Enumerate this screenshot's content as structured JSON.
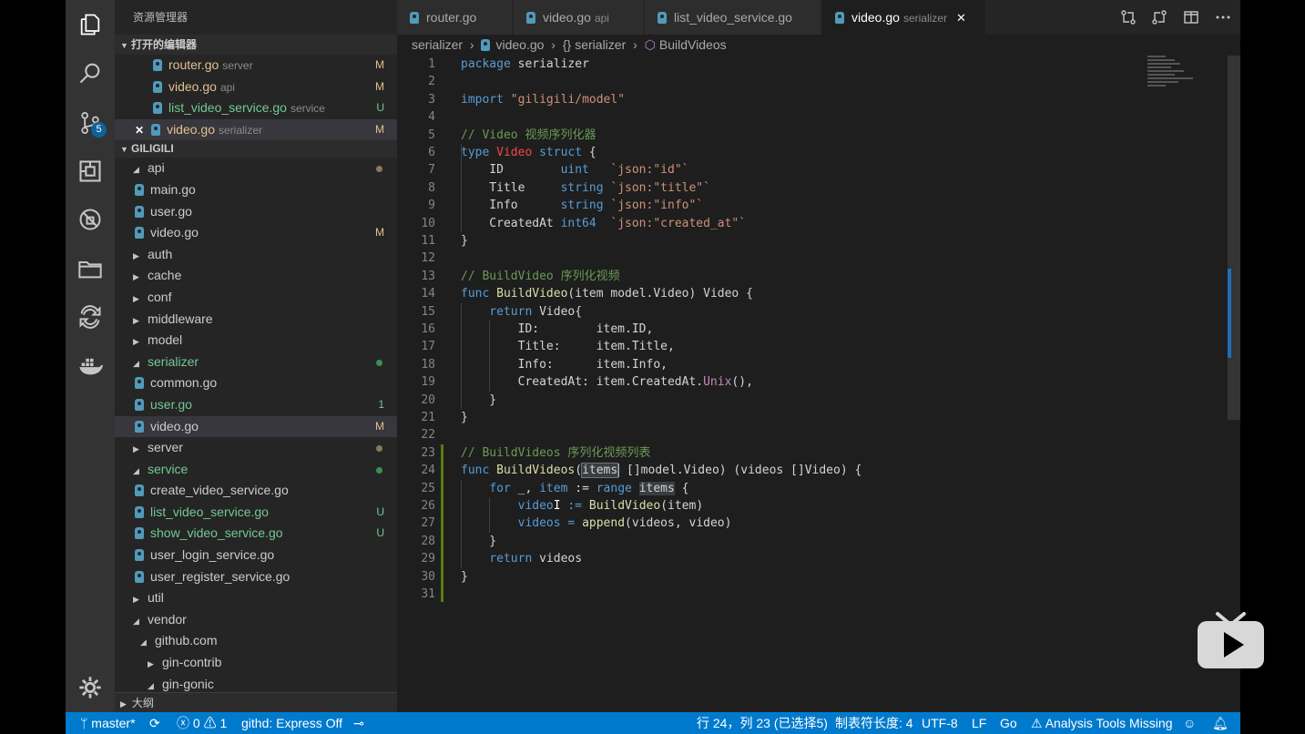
{
  "sidebar": {
    "title": "资源管理器",
    "open_editors_title": "打开的编辑器",
    "open_editors": [
      {
        "name": "router.go",
        "desc": "server",
        "status": "M"
      },
      {
        "name": "video.go",
        "desc": "api",
        "status": "M"
      },
      {
        "name": "list_video_service.go",
        "desc": "service",
        "status": "U"
      },
      {
        "name": "video.go",
        "desc": "serializer",
        "status": "M"
      }
    ],
    "close_glyph": "✕",
    "project_title": "GILIGILI",
    "tree": [
      {
        "label": "api",
        "kind": "folder-open",
        "status": "dot"
      },
      {
        "label": "main.go",
        "kind": "file"
      },
      {
        "label": "user.go",
        "kind": "file"
      },
      {
        "label": "video.go",
        "kind": "file",
        "status": "M"
      },
      {
        "label": "auth",
        "kind": "folder"
      },
      {
        "label": "cache",
        "kind": "folder"
      },
      {
        "label": "conf",
        "kind": "folder"
      },
      {
        "label": "middleware",
        "kind": "folder"
      },
      {
        "label": "model",
        "kind": "folder"
      },
      {
        "label": "serializer",
        "kind": "folder-open",
        "status": "dot-green"
      },
      {
        "label": "common.go",
        "kind": "file"
      },
      {
        "label": "user.go",
        "kind": "file",
        "status": "1"
      },
      {
        "label": "video.go",
        "kind": "file",
        "status": "M"
      },
      {
        "label": "server",
        "kind": "folder",
        "status": "dot"
      },
      {
        "label": "service",
        "kind": "folder-open",
        "status": "dot-green"
      },
      {
        "label": "create_video_service.go",
        "kind": "file"
      },
      {
        "label": "list_video_service.go",
        "kind": "file",
        "status": "U"
      },
      {
        "label": "show_video_service.go",
        "kind": "file",
        "status": "U"
      },
      {
        "label": "user_login_service.go",
        "kind": "file"
      },
      {
        "label": "user_register_service.go",
        "kind": "file"
      },
      {
        "label": "util",
        "kind": "folder"
      },
      {
        "label": "vendor",
        "kind": "folder-open"
      },
      {
        "label": "github.com",
        "kind": "folder-open"
      },
      {
        "label": "gin-contrib",
        "kind": "folder"
      },
      {
        "label": "gin-gonic",
        "kind": "folder-open"
      }
    ],
    "outline_title": "大纲"
  },
  "activity": {
    "scm_badge": "5"
  },
  "tabs": [
    {
      "name": "router.go",
      "desc": ""
    },
    {
      "name": "video.go",
      "desc": "api"
    },
    {
      "name": "list_video_service.go",
      "desc": ""
    },
    {
      "name": "video.go",
      "desc": "serializer"
    }
  ],
  "breadcrumb": {
    "folder": "serializer",
    "file": "video.go",
    "pkg": "serializer",
    "symbol": "BuildVideos",
    "sep": "›",
    "pkg_glyph": "{}"
  },
  "editor": {
    "line_numbers": [
      "1",
      "2",
      "3",
      "4",
      "5",
      "6",
      "7",
      "8",
      "9",
      "10",
      "11",
      "12",
      "13",
      "14",
      "15",
      "16",
      "17",
      "18",
      "19",
      "20",
      "21",
      "22",
      "23",
      "24",
      "25",
      "26",
      "27",
      "28",
      "29",
      "30",
      "31"
    ]
  },
  "status": {
    "branch": "master*",
    "errors": "0",
    "warnings": "1",
    "githd": "githd: Express Off",
    "position": "行 24，列 23 (已选择5)",
    "tab_size": "制表符长度: 4",
    "encoding": "UTF-8",
    "eol": "LF",
    "language": "Go",
    "analysis": "Analysis Tools Missing"
  },
  "colors": {
    "accent": "#007acc",
    "activity_bg": "#333333",
    "sidebar_bg": "#252526",
    "editor_bg": "#1e1e1e"
  }
}
